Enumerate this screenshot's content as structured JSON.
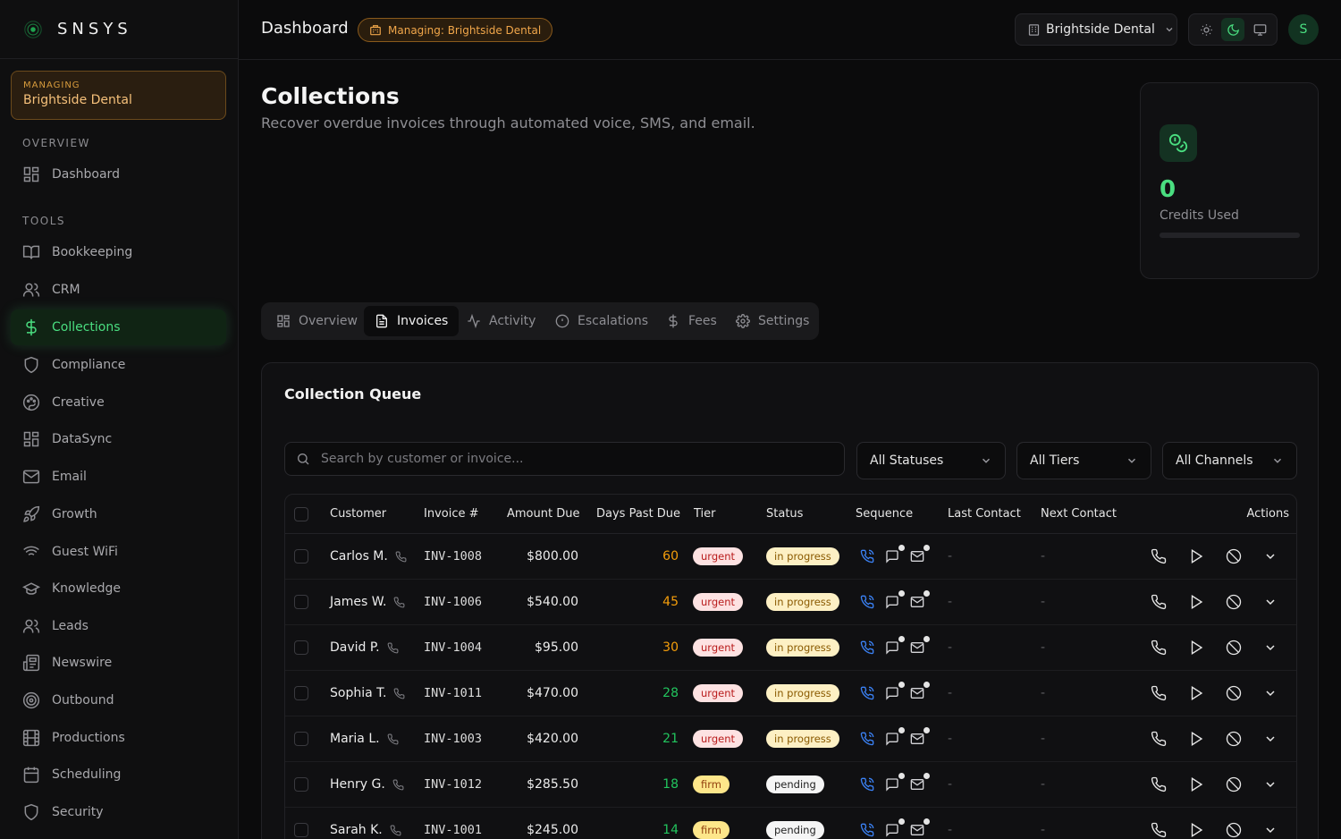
{
  "brand": {
    "name": "SNSYS"
  },
  "managing": {
    "label": "MANAGING",
    "value": "Brightside Dental"
  },
  "sidebar": {
    "overview_label": "OVERVIEW",
    "tools_label": "TOOLS",
    "items": [
      {
        "label": "Dashboard",
        "icon": "grid-icon"
      },
      {
        "label": "Bookkeeping",
        "icon": "book-icon"
      },
      {
        "label": "CRM",
        "icon": "users-icon"
      },
      {
        "label": "Collections",
        "icon": "dollar-icon",
        "active": true
      },
      {
        "label": "Compliance",
        "icon": "shield-icon"
      },
      {
        "label": "Creative",
        "icon": "palette-icon"
      },
      {
        "label": "DataSync",
        "icon": "grid-icon"
      },
      {
        "label": "Email",
        "icon": "mail-icon"
      },
      {
        "label": "Growth",
        "icon": "rocket-icon"
      },
      {
        "label": "Guest WiFi",
        "icon": "wifi-icon"
      },
      {
        "label": "Knowledge",
        "icon": "graduation-cap-icon"
      },
      {
        "label": "Leads",
        "icon": "users-icon"
      },
      {
        "label": "Newswire",
        "icon": "newspaper-icon"
      },
      {
        "label": "Outbound",
        "icon": "target-icon"
      },
      {
        "label": "Productions",
        "icon": "film-icon"
      },
      {
        "label": "Scheduling",
        "icon": "calendar-icon"
      },
      {
        "label": "Security",
        "icon": "shield-icon"
      }
    ]
  },
  "header": {
    "title": "Dashboard",
    "badge": "Managing: Brightside Dental",
    "org": "Brightside Dental",
    "avatar": "S"
  },
  "page": {
    "title": "Collections",
    "subtitle": "Recover overdue invoices through automated voice, SMS, and email."
  },
  "credits": {
    "value": "0",
    "label": "Credits Used",
    "progress": 0
  },
  "tabs": [
    {
      "label": "Overview",
      "icon": "grid-icon"
    },
    {
      "label": "Invoices",
      "icon": "file-text-icon",
      "active": true
    },
    {
      "label": "Activity",
      "icon": "activity-icon"
    },
    {
      "label": "Escalations",
      "icon": "alert-circle-icon"
    },
    {
      "label": "Fees",
      "icon": "dollar-icon"
    },
    {
      "label": "Settings",
      "icon": "gear-icon"
    }
  ],
  "queue": {
    "title": "Collection Queue",
    "search_placeholder": "Search by customer or invoice...",
    "filters": [
      "All Statuses",
      "All Tiers",
      "All Channels"
    ],
    "columns": [
      "Customer",
      "Invoice #",
      "Amount Due",
      "Days Past Due",
      "Tier",
      "Status",
      "Sequence",
      "Last Contact",
      "Next Contact",
      "Actions"
    ],
    "rows": [
      {
        "customer": "Carlos M.",
        "invoice": "INV-1008",
        "amount": "$800.00",
        "days": "60",
        "tier": "urgent",
        "status": "in progress",
        "last": "-",
        "next": "-"
      },
      {
        "customer": "James W.",
        "invoice": "INV-1006",
        "amount": "$540.00",
        "days": "45",
        "tier": "urgent",
        "status": "in progress",
        "last": "-",
        "next": "-"
      },
      {
        "customer": "David P.",
        "invoice": "INV-1004",
        "amount": "$95.00",
        "days": "30",
        "tier": "urgent",
        "status": "in progress",
        "last": "-",
        "next": "-"
      },
      {
        "customer": "Sophia T.",
        "invoice": "INV-1011",
        "amount": "$470.00",
        "days": "28",
        "tier": "urgent",
        "status": "in progress",
        "last": "-",
        "next": "-"
      },
      {
        "customer": "Maria L.",
        "invoice": "INV-1003",
        "amount": "$420.00",
        "days": "21",
        "tier": "urgent",
        "status": "in progress",
        "last": "-",
        "next": "-"
      },
      {
        "customer": "Henry G.",
        "invoice": "INV-1012",
        "amount": "$285.50",
        "days": "18",
        "tier": "firm",
        "status": "pending",
        "last": "-",
        "next": "-"
      },
      {
        "customer": "Sarah K.",
        "invoice": "INV-1001",
        "amount": "$245.00",
        "days": "14",
        "tier": "firm",
        "status": "pending",
        "last": "-",
        "next": "-"
      }
    ]
  },
  "colors": {
    "accent": "#4ade80",
    "amber": "#f0a64a",
    "days_high": "#f59e0b",
    "days_low": "#22c55e",
    "urgent_bg": "#fde2e2",
    "urgent_fg": "#b91c1c",
    "firm_bg": "#fde68a",
    "firm_fg": "#92400e",
    "inprogress_bg": "#fdf0c4",
    "inprogress_fg": "#8a5a00",
    "pending_bg": "#f5f5f5",
    "pending_fg": "#222222"
  }
}
